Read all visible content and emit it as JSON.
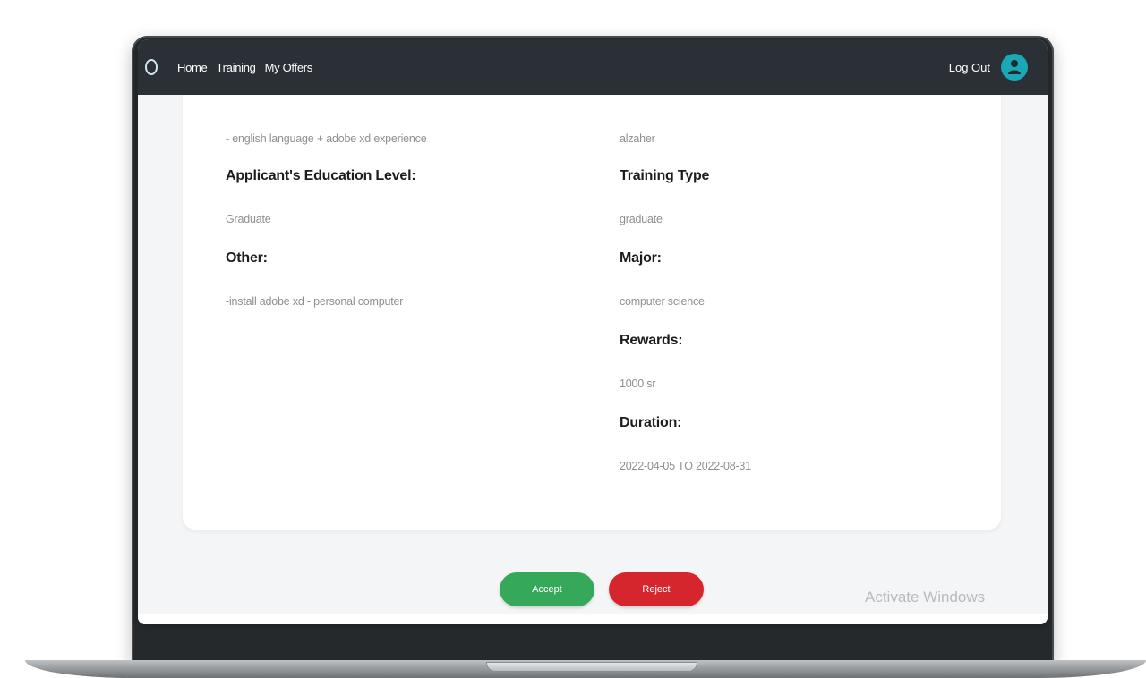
{
  "nav": {
    "links": [
      "Home",
      "Training",
      "My Offers"
    ],
    "logout_label": "Log Out"
  },
  "details": {
    "left": {
      "skills_value": "- english language + adobe xd experience",
      "education_heading": "Applicant's Education Level:",
      "education_value": "Graduate",
      "other_heading": "Other:",
      "other_value": "-install adobe xd - personal computer"
    },
    "right": {
      "company_value": "alzaher",
      "training_type_heading": "Training Type",
      "training_type_value": "graduate",
      "major_heading": "Major:",
      "major_value": "computer science",
      "rewards_heading": "Rewards:",
      "rewards_value": "1000 sr",
      "duration_heading": "Duration:",
      "duration_value": "2022-04-05 TO 2022-08-31"
    }
  },
  "actions": {
    "accept_label": "Accept",
    "reject_label": "Reject"
  },
  "watermark": "Activate Windows",
  "colors": {
    "navbar": "#2b3036",
    "avatar": "#1aa7b6",
    "accept": "#36a85a",
    "reject": "#d6262d"
  }
}
